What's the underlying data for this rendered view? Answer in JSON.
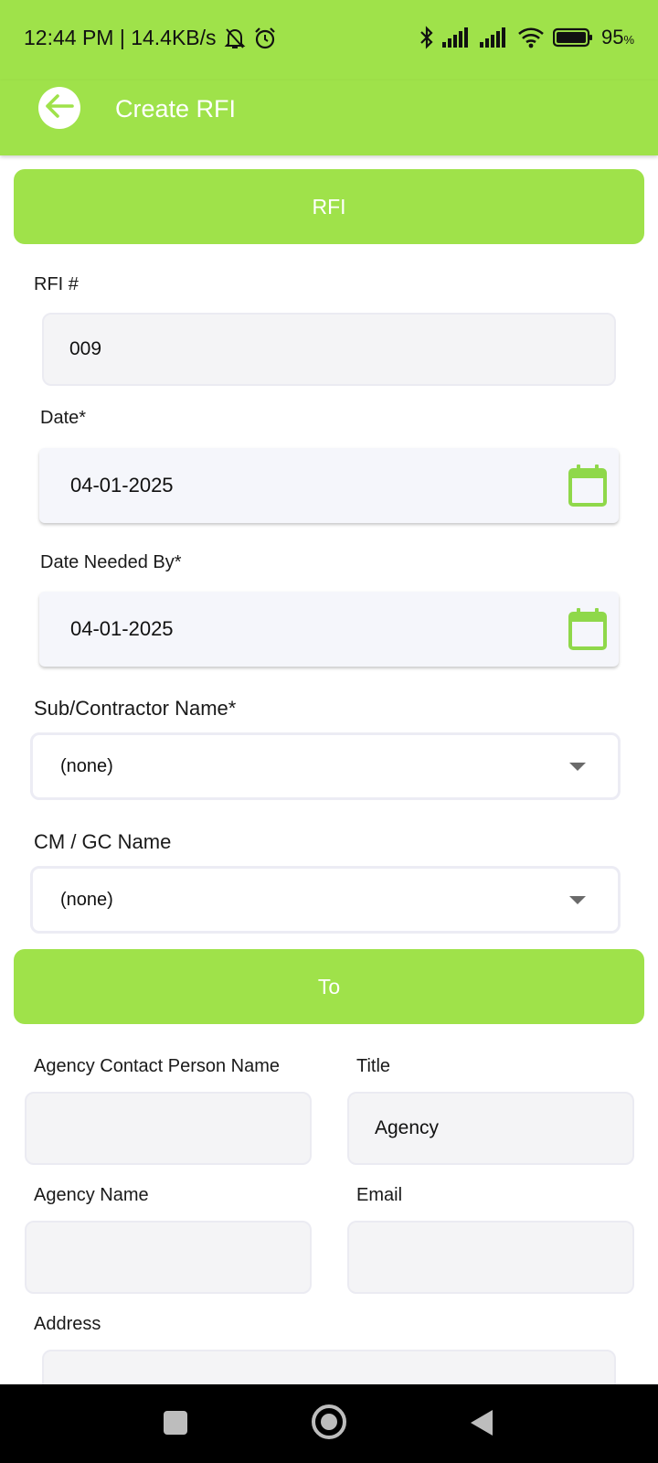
{
  "status_bar": {
    "time_speed": "12:44 PM | 14.4KB/s",
    "battery_pct": "95",
    "battery_unit": "%",
    "icons": [
      "bell-off-icon",
      "alarm-icon",
      "bluetooth-icon",
      "signal-icon",
      "signal-icon",
      "wifi-icon",
      "battery-icon"
    ]
  },
  "app_bar": {
    "title": "Create RFI",
    "back_icon": "arrow-left-icon"
  },
  "colors": {
    "accent": "#9fe24a",
    "field_bg": "#f4f4f6",
    "calendar_icon": "#8fd84a"
  },
  "sections": {
    "rfi": "RFI",
    "to": "To"
  },
  "form": {
    "rfi_number": {
      "label": "RFI #",
      "value": "009"
    },
    "date": {
      "label": "Date*",
      "value": "04-01-2025"
    },
    "date_needed_by": {
      "label": "Date Needed By*",
      "value": "04-01-2025"
    },
    "subcontractor": {
      "label": "Sub/Contractor Name*",
      "selected": "(none)"
    },
    "cm_gc": {
      "label": "CM / GC Name",
      "selected": "(none)"
    }
  },
  "to": {
    "agency_contact": {
      "label": "Agency Contact Person Name",
      "value": ""
    },
    "title": {
      "label": "Title",
      "value": "Agency"
    },
    "agency_name": {
      "label": "Agency Name",
      "value": ""
    },
    "email": {
      "label": "Email",
      "value": ""
    },
    "address": {
      "label": "Address",
      "value": ""
    }
  }
}
